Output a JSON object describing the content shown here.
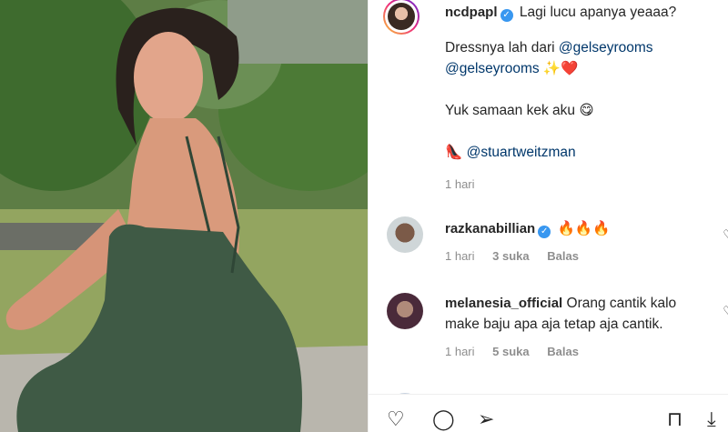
{
  "caption": {
    "username": "ncdpapl",
    "line1": "Lagi lucu apanya yeaaa?",
    "dress_prefix": "Dressnya lah dari",
    "mention1": "@gelseyrooms",
    "mention2": "@gelseyrooms",
    "emoji_line2": "✨❤️",
    "line3": "Yuk samaan kek aku",
    "line3_emoji": "😋",
    "shoe_emoji": "👠",
    "mention3": "@stuartweitzman",
    "time": "1 hari"
  },
  "comments": [
    {
      "username": "razkanabillian",
      "text": "🔥🔥🔥",
      "time": "1 hari",
      "likes": "3 suka",
      "reply": "Balas"
    },
    {
      "username": "melanesia_official",
      "text_line1": "Orang cantik kalo",
      "text_line2": "make baju apa aja tetap aja cantik.",
      "time": "1 hari",
      "likes": "5 suka",
      "reply": "Balas"
    }
  ],
  "icons": [
    "verified-badge",
    "heart-icon",
    "comment-icon",
    "share-icon",
    "bookmark-icon"
  ],
  "colors": {
    "mention": "#00376b",
    "meta": "#8e8e8e",
    "verified": "#3897f0",
    "text": "#262626"
  }
}
